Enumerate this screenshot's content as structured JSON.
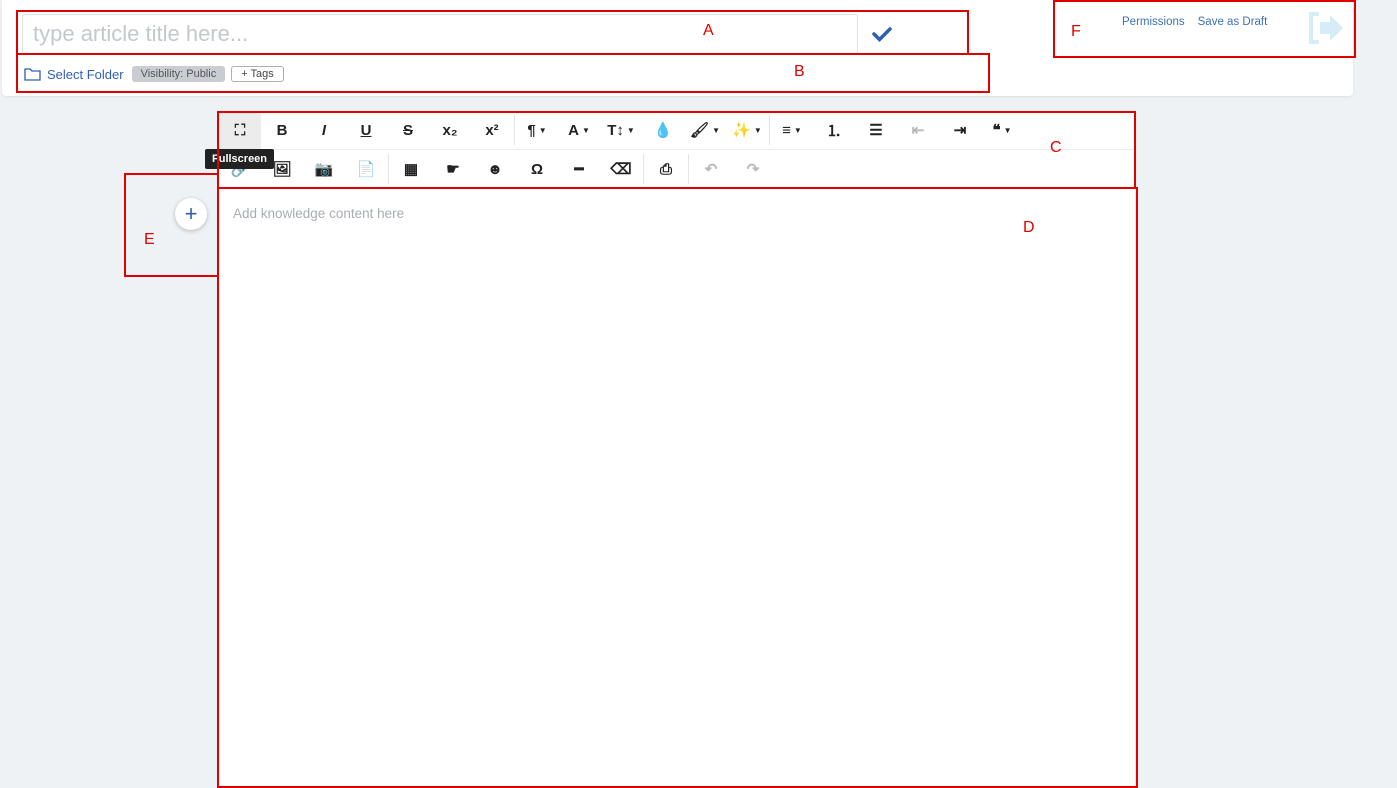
{
  "header": {
    "title_placeholder": "type article title here...",
    "folder_label": "Select Folder",
    "visibility_label": "Visibility: Public",
    "tags_label": "+ Tags",
    "permissions_label": "Permissions",
    "save_draft_label": "Save as Draft"
  },
  "toolbar": {
    "row1": [
      {
        "name": "fullscreen-icon",
        "glyph": "⛶",
        "active": true
      },
      {
        "name": "bold-icon",
        "glyph": "B"
      },
      {
        "name": "italic-icon",
        "glyph": "I"
      },
      {
        "name": "underline-icon",
        "glyph": "U"
      },
      {
        "name": "strikethrough-icon",
        "glyph": "S"
      },
      {
        "name": "subscript-icon",
        "glyph": "x₂"
      },
      {
        "name": "superscript-icon",
        "glyph": "x²"
      },
      {
        "sep": true
      },
      {
        "name": "paragraph-format-icon",
        "glyph": "¶",
        "caret": true
      },
      {
        "name": "font-family-icon",
        "glyph": "A",
        "caret": true
      },
      {
        "name": "font-size-icon",
        "glyph": "T↕",
        "caret": true
      },
      {
        "name": "color-drop-icon",
        "glyph": "💧"
      },
      {
        "name": "paint-brush-icon",
        "glyph": "🖌",
        "caret": true
      },
      {
        "name": "magic-wand-icon",
        "glyph": "✨",
        "caret": true
      },
      {
        "sep": true
      },
      {
        "name": "align-icon",
        "glyph": "≡",
        "caret": true
      },
      {
        "name": "ordered-list-icon",
        "glyph": "⒈"
      },
      {
        "name": "unordered-list-icon",
        "glyph": "☰"
      },
      {
        "name": "outdent-icon",
        "glyph": "⇤",
        "disabled": true
      },
      {
        "name": "indent-icon",
        "glyph": "⇥"
      },
      {
        "name": "quote-icon",
        "glyph": "❝",
        "caret": true
      }
    ],
    "row2": [
      {
        "name": "link-icon",
        "glyph": "🔗"
      },
      {
        "name": "image-icon",
        "glyph": "🖼"
      },
      {
        "name": "camera-icon",
        "glyph": "📷"
      },
      {
        "name": "file-icon",
        "glyph": "📄"
      },
      {
        "sep": true
      },
      {
        "name": "table-icon",
        "glyph": "▦"
      },
      {
        "name": "hand-pointer-icon",
        "glyph": "☛"
      },
      {
        "name": "emoticon-icon",
        "glyph": "☻"
      },
      {
        "name": "special-char-icon",
        "glyph": "Ω"
      },
      {
        "name": "horizontal-line-icon",
        "glyph": "━"
      },
      {
        "name": "eraser-icon",
        "glyph": "⌫"
      },
      {
        "sep": true
      },
      {
        "name": "print-icon",
        "glyph": "⎙"
      },
      {
        "sep": true
      },
      {
        "name": "undo-icon",
        "glyph": "↶",
        "disabled": true
      },
      {
        "name": "redo-icon",
        "glyph": "↷",
        "disabled": true
      }
    ]
  },
  "tooltip": "Fullscreen",
  "editor": {
    "placeholder": "Add knowledge content here"
  },
  "annotations": {
    "a": "A",
    "b": "B",
    "c": "C",
    "d": "D",
    "e": "E",
    "f": "F"
  },
  "colors": {
    "accent": "#2f5fb3",
    "annotation": "#e00000",
    "background": "#eef2f5"
  }
}
